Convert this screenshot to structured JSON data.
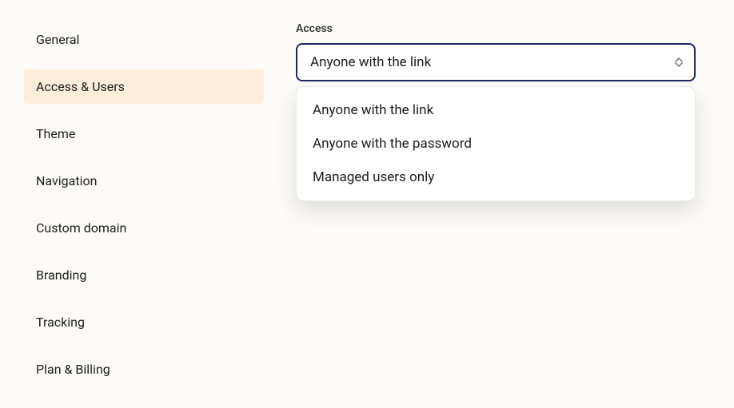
{
  "sidebar": {
    "items": [
      {
        "label": "General",
        "active": false
      },
      {
        "label": "Access & Users",
        "active": true
      },
      {
        "label": "Theme",
        "active": false
      },
      {
        "label": "Navigation",
        "active": false
      },
      {
        "label": "Custom domain",
        "active": false
      },
      {
        "label": "Branding",
        "active": false
      },
      {
        "label": "Tracking",
        "active": false
      },
      {
        "label": "Plan & Billing",
        "active": false
      }
    ]
  },
  "main": {
    "access": {
      "label": "Access",
      "selected": "Anyone with the link",
      "options": [
        "Anyone with the link",
        "Anyone with the password",
        "Managed users only"
      ]
    }
  }
}
